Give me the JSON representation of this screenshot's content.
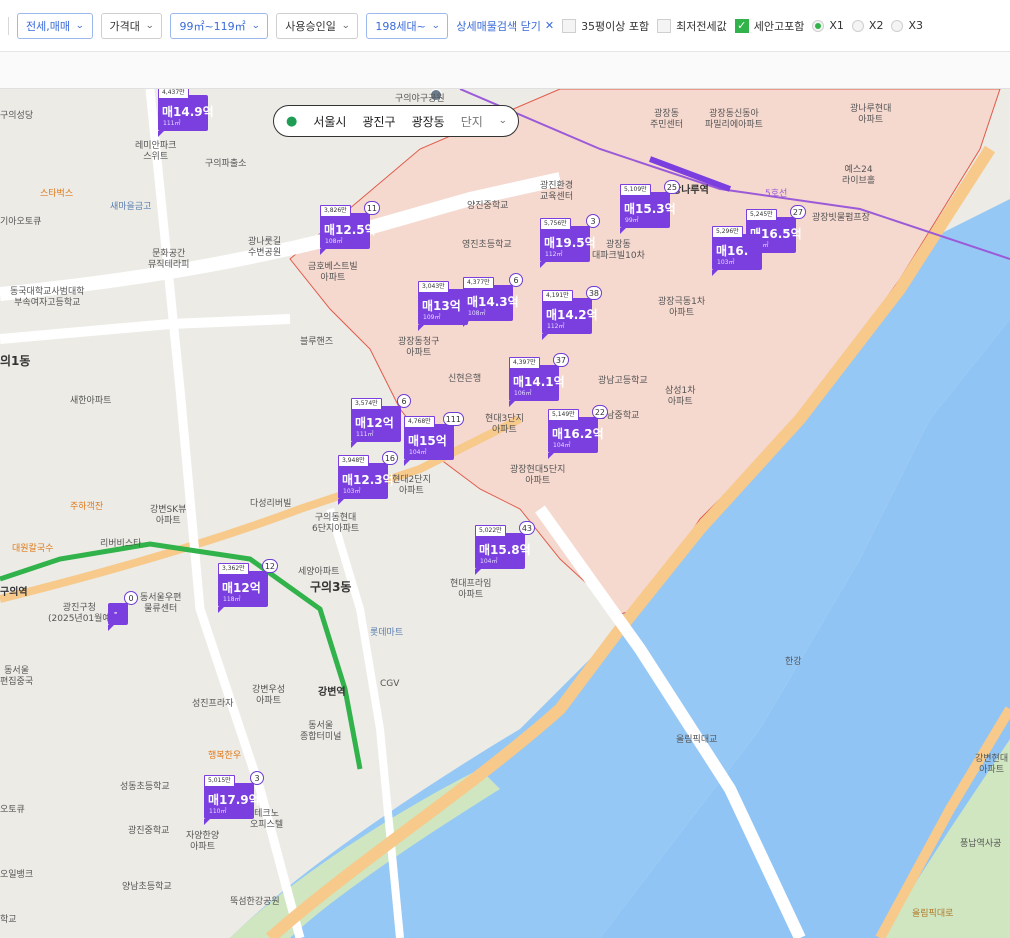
{
  "filters": {
    "trade_type": "전세,매매",
    "price": "가격대",
    "area": "99㎡~119㎡",
    "approval": "사용승인일",
    "households": "198세대~",
    "close_detail": "상세매물검색 닫기",
    "close_icon": "x-icon",
    "opt_35": "35평이상 포함",
    "opt_min_jeonse": "최저전세값",
    "opt_tax": "세안고포함",
    "x1": "X1",
    "x2": "X2",
    "x3": "X3"
  },
  "breadcrumb": {
    "city": "서울시",
    "district": "광진구",
    "dong": "광장동",
    "type": "단지"
  },
  "colors": {
    "marker": "#7b3fe0",
    "water": "#8fc4f5",
    "highlight": "#f5d8ce",
    "road": "#f7c98a"
  },
  "markers": [
    {
      "top": "4,437만",
      "price": "매14.9억",
      "area": "111㎡",
      "count": ""
    },
    {
      "top": "3,826만",
      "price": "매12.5억",
      "area": "108㎡",
      "count": "11"
    },
    {
      "top": "5,756만",
      "price": "매19.5억",
      "area": "112㎡",
      "count": "3"
    },
    {
      "top": "5,109만",
      "price": "매15.3억",
      "area": "99㎡",
      "count": "25"
    },
    {
      "top": "5,245만",
      "price": "매16.5억",
      "area": "104㎡",
      "count": "27"
    },
    {
      "top": "5,296만",
      "price": "매16.",
      "area": "103㎡",
      "count": ""
    },
    {
      "top": "3,043만",
      "price": "매13억",
      "area": "109㎡",
      "count": ""
    },
    {
      "top": "4,377만",
      "price": "매14.3억",
      "area": "108㎡",
      "count": "6"
    },
    {
      "top": "4,191만",
      "price": "매14.2억",
      "area": "112㎡",
      "count": "38"
    },
    {
      "top": "4,397만",
      "price": "매14.1억",
      "area": "106㎡",
      "count": "37"
    },
    {
      "top": "3,574만",
      "price": "매12억",
      "area": "111㎡",
      "count": "6"
    },
    {
      "top": "4,768만",
      "price": "매15억",
      "area": "104㎡",
      "count": "111"
    },
    {
      "top": "5,149만",
      "price": "매16.2억",
      "area": "104㎡",
      "count": "22"
    },
    {
      "top": "3,948만",
      "price": "매12.3억",
      "area": "103㎡",
      "count": "16"
    },
    {
      "top": "5,022만",
      "price": "매15.8억",
      "area": "104㎡",
      "count": "43"
    },
    {
      "top": "3,362만",
      "price": "매12억",
      "area": "118㎡",
      "count": "12"
    },
    {
      "top": "",
      "price": "-",
      "area": "",
      "count": "0"
    },
    {
      "top": "5,015만",
      "price": "매17.9억",
      "area": "110㎡",
      "count": "3"
    }
  ],
  "labels": {
    "l1": "구의야구공원",
    "l2": "광장동\n주민센터",
    "l3": "광장동신동아\n파밀리에아파트",
    "l4": "광나루현대\n아파트",
    "l5": "레미안파크\n스위트",
    "l6": "구의파출소",
    "l7": "스타벅스",
    "l8": "새마을금고",
    "l9": "기아오토큐",
    "l10": "문화공간\n뮤직테라피",
    "l11": "광나룻길\n수변공원",
    "l12": "금호베스트빌\n아파트",
    "l13": "양진중학교",
    "l14": "광진환경\n교육센터",
    "l15": "광나루역",
    "l16": "예스24\n라이브홀",
    "l17": "광장빗물펌프장",
    "l18": "동국대학교사범대학\n부속여자고등학교",
    "l19": "영진초등학교",
    "l20": "광장동\n대파크빌10차",
    "l21": "광장극동1차\n아파트",
    "l22": "블루핸즈",
    "l23": "광장동청구\n아파트",
    "l24": "의1동",
    "l25": "신현은행",
    "l26": "광남고등학교",
    "l27": "삼성1차\n아파트",
    "l28": "새한아파트",
    "l29": "현대3단지\n아파트",
    "l30": "광남중학교",
    "l31": "광장현대5단지\n아파트",
    "l32": "현대2단지\n아파트",
    "l33": "다성리버빌",
    "l34": "구의동현대\n6단지아파트",
    "l35": "주하객잔",
    "l36": "강변SK뷰\n아파트",
    "l37": "리버비스타",
    "l38": "대원칼국수",
    "l39": "세양아파트",
    "l40": "구의3동",
    "l41": "구의역",
    "l42": "광진구청\n(2025년01월예",
    "l43": "동서울우편\n물류센터",
    "l44": "현대프라임\n아파트",
    "l45": "롯데마트",
    "l46": "CGV",
    "l47": "동서울\n편집중국",
    "l48": "강변우성\n아파트",
    "l49": "성진프라자",
    "l50": "강변역",
    "l51": "동서울\n종합터미널",
    "l52": "한강",
    "l53": "올림픽대교",
    "l54": "행복한우",
    "l55": "성동초등학교",
    "l56": "테크노\n오피스텔",
    "l57": "광진중학교",
    "l58": "자양한양\n아파트",
    "l59": "양남초등학교",
    "l60": "뚝섬한강공원",
    "l61": "강변현대\n아파트",
    "l62": "풍납역사공",
    "l63": "오토큐",
    "l64": "오일뱅크",
    "l65": "5호선",
    "l66": "올림픽대로",
    "l67": "학교",
    "l68": "구의성당"
  }
}
